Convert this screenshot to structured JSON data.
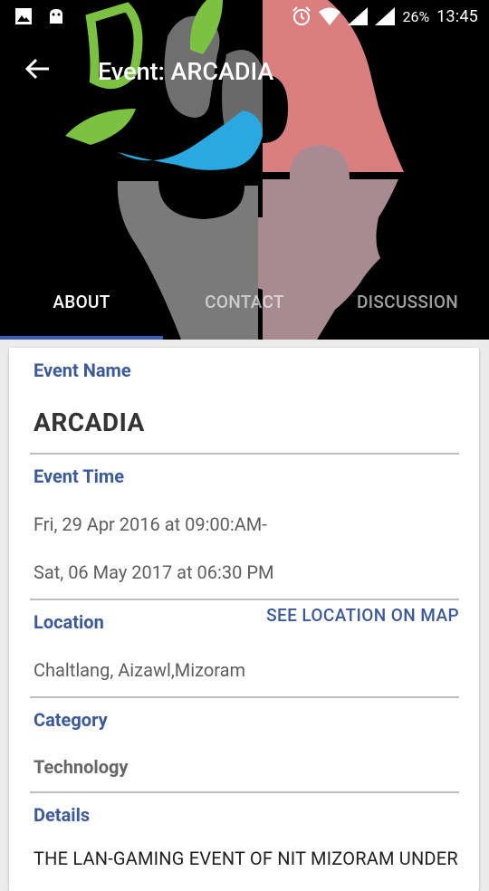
{
  "status_bar": {
    "time": "13:45",
    "battery": "26%",
    "icons": [
      "image-icon",
      "android-icon",
      "alarm-icon",
      "wifi-icon",
      "signal-icon",
      "signal-icon",
      "battery-icon"
    ]
  },
  "app_bar": {
    "title": "Event: ARCADIA",
    "back_icon": "arrow-back-icon"
  },
  "tabs": [
    {
      "label": "ABOUT",
      "active": true
    },
    {
      "label": "CONTACT",
      "active": false
    },
    {
      "label": "DISCUSSION",
      "active": false
    }
  ],
  "event": {
    "name_label": "Event Name",
    "name": "ARCADIA",
    "time_label": "Event Time",
    "start": "Fri, 29 Apr 2016 at 09:00:AM-",
    "end": "Sat, 06 May 2017 at 06:30 PM",
    "location_label": "Location",
    "map_link": "SEE LOCATION ON MAP",
    "location": "Chaltlang, Aizawl,Mizoram",
    "category_label": "Category",
    "category": "Technology",
    "details_label": "Details",
    "details": "THE LAN-GAMING EVENT OF NIT MIZORAM UNDER"
  },
  "colors": {
    "accent": "#3c5a99",
    "indicator": "#3b5bb5",
    "header_bg": "#000000",
    "puzzle_pink": "#d97f7f",
    "puzzle_mauve": "#a88a93",
    "puzzle_gray": "#7a7a7a",
    "leaf_green": "#7cc242",
    "splash_blue": "#2aa9e0"
  }
}
